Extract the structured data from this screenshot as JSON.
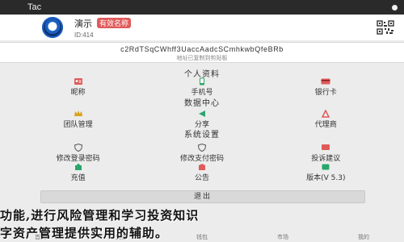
{
  "status": {
    "carrier": "Tac"
  },
  "profile": {
    "name": "演示",
    "badge": "有效名称",
    "id": "ID:414"
  },
  "wallet": {
    "address": "c2RdTSqCWhff3UaccAadcSCmhkwbQfeBRb",
    "note": "地址已复制到剪贴板"
  },
  "sections": {
    "personal": "个人资料",
    "data": "数据中心",
    "system": "系统设置"
  },
  "personal_items": [
    {
      "label": "昵称",
      "icon": "id-card-icon"
    },
    {
      "label": "手机号",
      "icon": "phone-icon"
    },
    {
      "label": "银行卡",
      "icon": "bank-card-icon"
    }
  ],
  "data_items": [
    {
      "label": "团队管理",
      "icon": "crown-icon"
    },
    {
      "label": "分享",
      "icon": "share-icon"
    },
    {
      "label": "代理商",
      "icon": "agent-icon"
    }
  ],
  "system_items_row1": [
    {
      "label": "修改登录密码",
      "icon": "shield-icon"
    },
    {
      "label": "修改支付密码",
      "icon": "wallet-icon"
    },
    {
      "label": "投诉建议",
      "icon": "feedback-icon"
    }
  ],
  "system_items_row2": [
    {
      "label": "充值",
      "icon": "recharge-icon"
    },
    {
      "label": "公告",
      "icon": "announcement-icon"
    },
    {
      "label": "版本(V 5.3)",
      "icon": "version-icon"
    }
  ],
  "logout_label": "退出",
  "overlay": {
    "line1": "功能,进行风险管理和学习投资知识",
    "line2": "字资产管理提供实用的辅助。"
  },
  "tabs": [
    "首页",
    "交易",
    "钱包",
    "市场",
    "我的"
  ],
  "colors": {
    "accent_red": "#e05a5a",
    "accent_green": "#2aa66a",
    "accent_blue": "#2f6fd6",
    "statusbar": "#2a2a2a"
  }
}
